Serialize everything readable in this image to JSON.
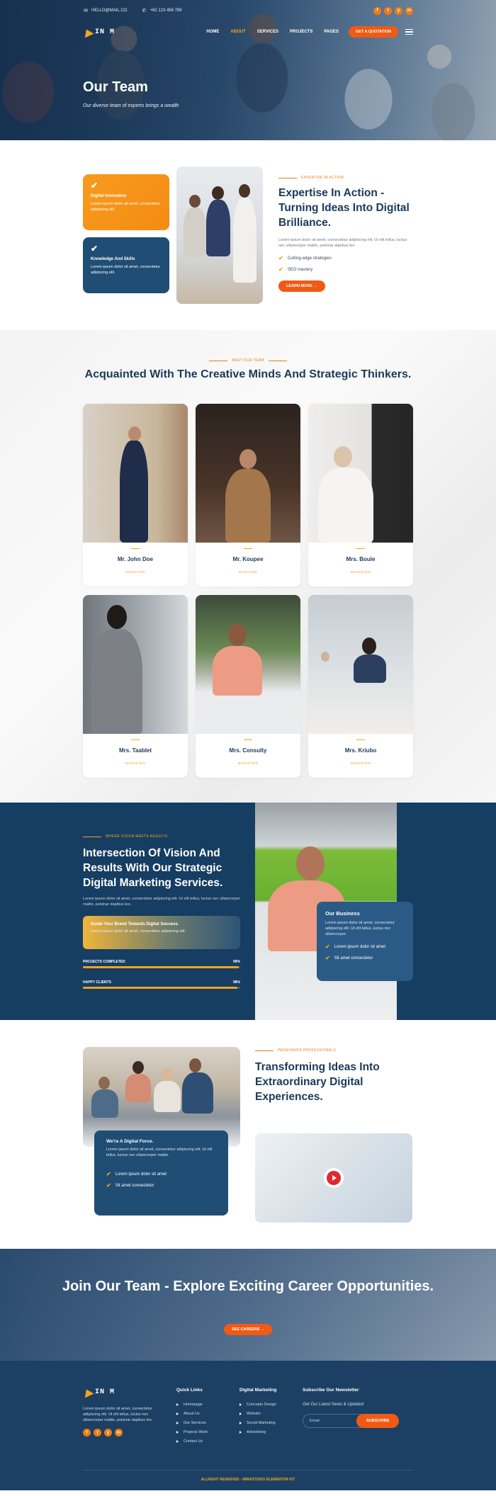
{
  "topbar": {
    "email": "HELLO@MAIL.CO",
    "phone": "+62 123 456 789",
    "social": [
      "f",
      "t",
      "y",
      "in"
    ]
  },
  "brand": {
    "logo_text": "IN M"
  },
  "nav": {
    "items": [
      "HOME",
      "ABOUT",
      "SERVICES",
      "PROJECTS",
      "PAGES"
    ],
    "active": "ABOUT",
    "cta": "GET A QUOTATION"
  },
  "hero": {
    "title": "Our Team",
    "subtitle": "Our diverse team of experts brings a wealth"
  },
  "features": [
    {
      "title": "Digital Innovation",
      "text": "Lorem ipsum dolor sit amet, consectetur adipiscing elit."
    },
    {
      "title": "Knowledge And Skills",
      "text": "Lorem ipsum dolor sit amet, consectetur adipiscing elit."
    }
  ],
  "expertise": {
    "kicker": "EXPERTISE IN ACTION",
    "title": "Expertise In Action - Turning Ideas Into Digital Brilliance.",
    "text": "Lorem ipsum dolor sit amet, consectetur adipiscing elit. Ut elit tellus, luctus nec ullamcorper mattis, pulvinar dapibus leo.",
    "bullets": [
      "Cutting-edge strategies",
      "SEO mastery"
    ],
    "button": "LEARN MORE"
  },
  "team": {
    "kicker": "MEET OUR TEAM",
    "title": "Acquainted With The Creative Minds And Strategic Thinkers.",
    "members": [
      {
        "name": "Mr. John Doe",
        "role": "DIRECTOR"
      },
      {
        "name": "Mr. Koupee",
        "role": "MANAGER"
      },
      {
        "name": "Mrs. Boule",
        "role": "MARKETER"
      },
      {
        "name": "Mrs. Taablet",
        "role": "MARKETER"
      },
      {
        "name": "Mrs. Consulty",
        "role": "MARKETER"
      },
      {
        "name": "Mrs. Kriubo",
        "role": "MARKETER"
      }
    ]
  },
  "vision": {
    "kicker": "WHERE VISION MEETS RESULTS",
    "title": "Intersection Of Vision And Results With Our Strategic Digital Marketing Services.",
    "text": "Lorem ipsum dolor sit amet, consectetur adipiscing elit. Ut elit tellus, luctus nec ullamcorper mattis, pulvinar dapibus leo.",
    "guide_title": "Guide Your Brand Towards Digital Success.",
    "guide_text": "Lorem ipsum dolor sit amet, consectetur adipiscing elit.",
    "progress": [
      {
        "label": "PROJECTS COMPLETED",
        "value": "99%",
        "fraction": 0.99
      },
      {
        "label": "HAPPY CLIENTS",
        "value": "98%",
        "fraction": 0.98
      }
    ],
    "biz_title": "Our Business",
    "biz_text": "Lorem ipsum dolor sit amet, consectetur adipiscing elit. Ut elit tellus, luctus nec ullamcorper.",
    "biz_bullets": [
      "Lorem ipsum dolor sit amet",
      "Sit amet consectetur"
    ]
  },
  "transform": {
    "kicker": "PASSIONATE PROFESSIONALS",
    "title": "Transforming Ideas Into Extraordinary Digital Experiences.",
    "card_title": "We're A Digital Force.",
    "card_text": "Lorem ipsum dolor sit amet, consectetur adipiscing elit. Ut elit tellus, luctus nec ullamcorper mattis.",
    "bullets": [
      "Lorem ipsum dolor sit amet",
      "Sit amet consectetur"
    ]
  },
  "career": {
    "title": "Join Our Team - Explore Exciting Career Opportunities.",
    "button": "SEE CAREERS"
  },
  "footer": {
    "desc": "Lorem ipsum dolor sit amet, consectetur adipiscing elit. Ut elit tellus, luctus nec ullamcorper mattis, pulvinar dapibus leo.",
    "quick_title": "Quick Links",
    "quick": [
      "Homepage",
      "About Us",
      "Our Services",
      "Projects Work",
      "Contact Us"
    ],
    "dm_title": "Digital Marketing",
    "dm": [
      "Concepts Design",
      "Website",
      "Social Marketing",
      "Advertising"
    ],
    "news_title": "Subscribe Our Newsletter",
    "news_tag": "Get Our Latest News & Updated",
    "email_placeholder": "Email",
    "subscribe": "SUBSCRIBE",
    "copyright": "ALLRIGHT RESERVED - WIRASTUDIO ELEMENTOR KIT"
  },
  "colors": {
    "accent": "#f07c12",
    "navy": "#1b4064",
    "gold": "#f5a41c"
  }
}
